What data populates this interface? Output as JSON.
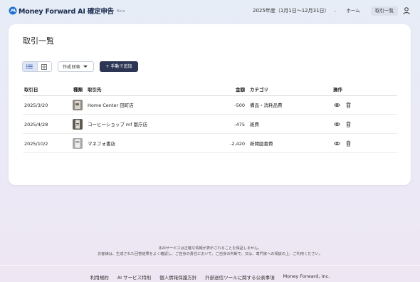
{
  "header": {
    "brand": "Money Forward AI 確定申告",
    "beta": "Beta",
    "fiscal_year": "2025年度（1月1日〜12月31日）",
    "nav_home": "ホーム",
    "nav_transactions": "取引一覧"
  },
  "page": {
    "title": "取引一覧",
    "sort_label": "作成日順",
    "add_label": "+ 手動で追加"
  },
  "table": {
    "columns": {
      "date": "取引日",
      "kind": "種類",
      "partner": "取引先",
      "amount": "金額",
      "category": "カテゴリ",
      "actions": "操作"
    },
    "rows": [
      {
        "date": "2025/3/20",
        "partner": "Home Center 田町店",
        "amount": "-500",
        "category": "備品・消耗品費"
      },
      {
        "date": "2025/4/28",
        "partner": "コーヒーショップ mf 都庁店",
        "amount": "-475",
        "category": "雑費"
      },
      {
        "date": "2025/10/2",
        "partner": "マネフォ書店",
        "amount": "-2,420",
        "category": "新聞図書費"
      }
    ]
  },
  "footer": {
    "note_line1": "本AIサービスは正確な情報が表示されることを保証しません。",
    "note_line2": "お客様は、生成された回答結果をよく確認し、ご自身の責任において、ご自身の判断で、又は、専門家への相談の上、ご利用ください。",
    "links": [
      "利用規約",
      "AI サービス特則",
      "個人情報保護方針",
      "外部送信ツールに関する公表事項",
      "Money Forward, Inc."
    ]
  },
  "colors": {
    "accent": "#2c3654",
    "card": "#ffffff"
  }
}
